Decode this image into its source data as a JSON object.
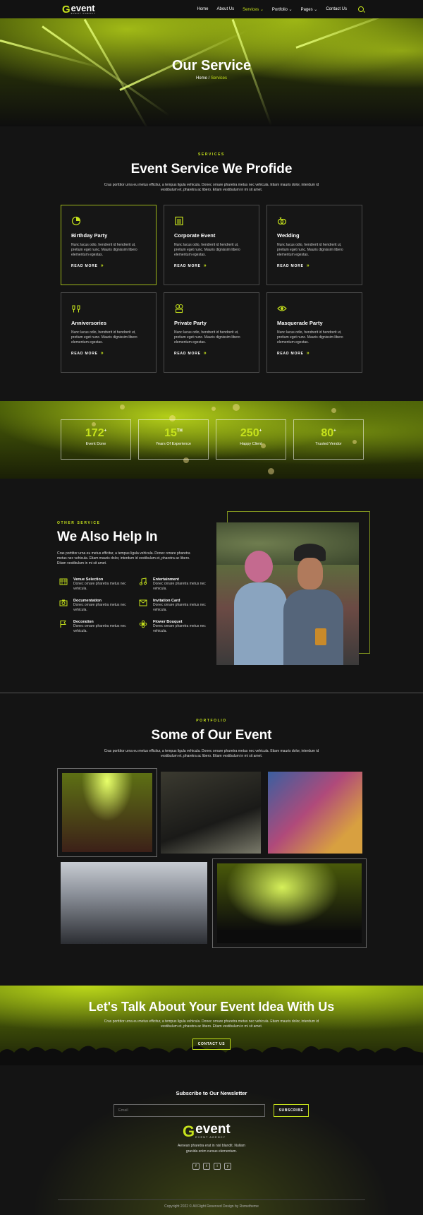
{
  "nav": {
    "logo_letter": "G",
    "logo_text": "event",
    "logo_sub": "EVENT AGENCY",
    "items": [
      {
        "label": "Home"
      },
      {
        "label": "About Us"
      },
      {
        "label": "Services ⌄"
      },
      {
        "label": "Portfolio ⌄"
      },
      {
        "label": "Pages ⌄"
      },
      {
        "label": "Contact Us"
      }
    ],
    "active_item": "Services",
    "search_icon": "search-icon"
  },
  "hero": {
    "title": "Our Service",
    "breadcrumb_home": "Home",
    "breadcrumb_sep": " / ",
    "breadcrumb_current": "Services"
  },
  "services": {
    "eyebrow": "SERVICES",
    "title": "Event Service We Profide",
    "description": "Cras porttitor urna eu metus efficitur, a tempus ligula vehicula. Donec ornare pharetra metus nec vehicula. Etiam mauris dolor, interdum id vestibulum et, pharetra ac libero. Etiam vestibulum in mi sit amet.",
    "cards": [
      {
        "title": "Birthday Party",
        "icon": "pie-chart-icon",
        "desc": "Nunc lacus odio, hendrerit id hendrerit ut, pretium eget nunc. Mauris dignissim libero elementum egestas.",
        "more": "READ MORE"
      },
      {
        "title": "Corporate Event",
        "icon": "building-icon",
        "desc": "Nunc lacus odio, hendrerit id hendrerit ut, pretium eget nunc. Mauris dignissim libero elementum egestas.",
        "more": "READ MORE"
      },
      {
        "title": "Wedding",
        "icon": "rings-icon",
        "desc": "Nunc lacus odio, hendrerit id hendrerit ut, pretium eget nunc. Mauris dignissim libero elementum egestas.",
        "more": "READ MORE"
      },
      {
        "title": "Anniversories",
        "icon": "toast-glasses-icon",
        "desc": "Nunc lacus odio, hendrerit id hendrerit ut, pretium eget nunc. Mauris dignissim libero elementum egestas.",
        "more": "READ MORE"
      },
      {
        "title": "Private Party",
        "icon": "party-icon",
        "desc": "Nunc lacus odio, hendrerit id hendrerit ut, pretium eget nunc. Mauris dignissim libero elementum egestas.",
        "more": "READ MORE"
      },
      {
        "title": "Masquerade Party",
        "icon": "eye-icon",
        "desc": "Nunc lacus odio, hendrerit id hendrerit ut, pretium eget nunc. Mauris dignissim libero elementum egestas.",
        "more": "READ MORE"
      }
    ]
  },
  "stats": [
    {
      "value": "172",
      "suffix": "+",
      "label": "Event Done"
    },
    {
      "value": "15",
      "suffix": "TH",
      "label": "Years Of Experience"
    },
    {
      "value": "250",
      "suffix": "+",
      "label": "Happy Client"
    },
    {
      "value": "80",
      "suffix": "+",
      "label": "Trusted Vendor"
    }
  ],
  "help": {
    "eyebrow": "OTHER SERVICE",
    "title": "We Also Help In",
    "description": "Cras porttitor urna eu metus efficitur, a tempus ligula vehicula. Donec ornare pharetra metus nec vehicula. Etiam mauris dolor, interdum id vestibulum et, pharetra ac libero. Etiam vestibulum in mi sit amet.",
    "items": [
      {
        "title": "Venue Selection",
        "desc": "Donec ornare pharetra metus nec vehicula.",
        "icon": "venue-icon"
      },
      {
        "title": "Entertainment",
        "desc": "Donec ornare pharetra metus nec vehicula.",
        "icon": "music-note-icon"
      },
      {
        "title": "Documentation",
        "desc": "Donec ornare pharetra metus nec vehicula.",
        "icon": "camera-icon"
      },
      {
        "title": "Invitation Card",
        "desc": "Donec ornare pharetra metus nec vehicula.",
        "icon": "card-icon"
      },
      {
        "title": "Decoration",
        "desc": "Donec ornare pharetra metus nec vehicula.",
        "icon": "flag-icon"
      },
      {
        "title": "Flower Bouquet",
        "desc": "Donec ornare pharetra metus nec vehicula.",
        "icon": "flower-icon"
      }
    ]
  },
  "portfolio": {
    "eyebrow": "PORTFOLIO",
    "title": "Some of Our Event",
    "description": "Cras porttitor urna eu metus efficitur, a tempus ligula vehicula. Donec ornare pharetra metus nec vehicula. Etiam mauris dolor, interdum id vestibulum et, pharetra ac libero. Etiam vestibulum in mi sit amet."
  },
  "cta": {
    "title": "Let's Talk About Your Event Idea With Us",
    "description": "Cras porttitor urna eu metus efficitur, a tempus ligula vehicula. Donec ornare pharetra metus nec vehicula. Etiam mauris dolor, interdum id vestibulum et, pharetra ac libero. Etiam vestibulum in mi sit amet.",
    "button": "CONTACT US"
  },
  "footer": {
    "newsletter_title": "Subscribe to Our Newsletter",
    "email_placeholder": "Email",
    "subscribe": "SUBSCRIBE",
    "logo_letter": "G",
    "logo_text": "event",
    "logo_sub": "EVENT AGENCY",
    "tagline_1": "Aenean pharetra erat in nisl blandit. Nullam",
    "tagline_2": "gravida enim cursus elementum.",
    "social": [
      "f",
      "t",
      "i",
      "y"
    ],
    "copyright": "Copyright 2022 © All Right Reserved Design by Rometheme"
  },
  "colors": {
    "accent": "#c6e21c",
    "background": "#141414"
  }
}
